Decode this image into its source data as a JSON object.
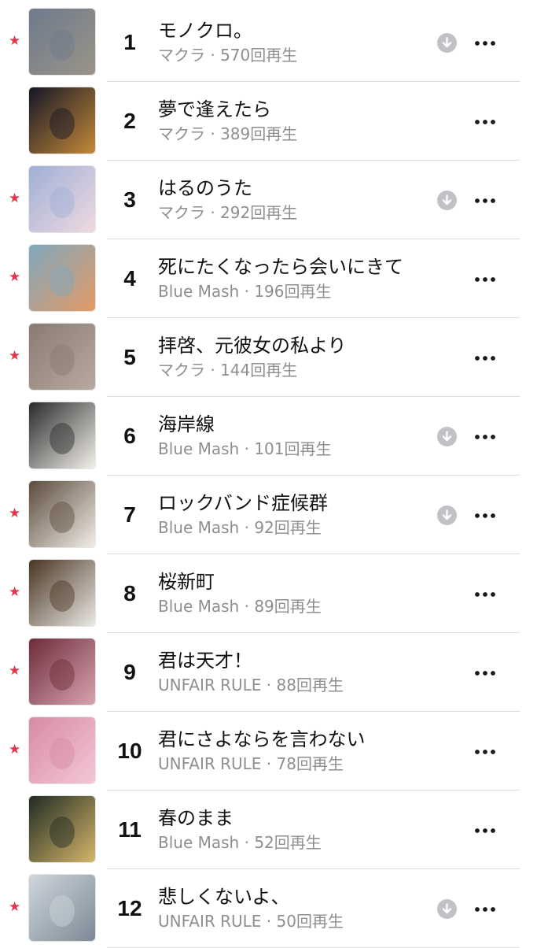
{
  "tracks": [
    {
      "rank": "1",
      "title": "モノクロ。",
      "artist": "マクラ",
      "plays": "570",
      "plays_suffix": "回再生",
      "starred": true,
      "downloaded": true,
      "art_icon": "album-art-city-silhouette",
      "art_colors": [
        "#6e7a8c",
        "#9a9488"
      ]
    },
    {
      "rank": "2",
      "title": "夢で逢えたら",
      "artist": "マクラ",
      "plays": "389",
      "plays_suffix": "回再生",
      "starred": false,
      "downloaded": false,
      "art_icon": "album-art-person-dark-room",
      "art_colors": [
        "#141526",
        "#c58b3a"
      ]
    },
    {
      "rank": "3",
      "title": "はるのうた",
      "artist": "マクラ",
      "plays": "292",
      "plays_suffix": "回再生",
      "starred": true,
      "downloaded": true,
      "art_icon": "album-art-cherry-blossoms",
      "art_colors": [
        "#9fb0d6",
        "#f0d9e0"
      ]
    },
    {
      "rank": "4",
      "title": "死にたくなったら会いにきて",
      "artist": "Blue Mash",
      "plays": "196",
      "plays_suffix": "回再生",
      "starred": true,
      "downloaded": false,
      "art_icon": "album-art-portrait-blue",
      "art_colors": [
        "#7fa8be",
        "#e39a66"
      ]
    },
    {
      "rank": "5",
      "title": "拝啓、元彼女の私より",
      "artist": "マクラ",
      "plays": "144",
      "plays_suffix": "回再生",
      "starred": true,
      "downloaded": false,
      "art_icon": "album-art-paper-note",
      "art_colors": [
        "#8a7b72",
        "#b8aaa0"
      ]
    },
    {
      "rank": "6",
      "title": "海岸線",
      "artist": "Blue Mash",
      "plays": "101",
      "plays_suffix": "回再生",
      "starred": false,
      "downloaded": true,
      "art_icon": "album-art-person-night-street",
      "art_colors": [
        "#2a2a2a",
        "#f4f1ec"
      ]
    },
    {
      "rank": "7",
      "title": "ロックバンド症候群",
      "artist": "Blue Mash",
      "plays": "92",
      "plays_suffix": "回再生",
      "starred": true,
      "downloaded": true,
      "art_icon": "album-art-room-collage",
      "art_colors": [
        "#5b4b3c",
        "#f2eee8"
      ]
    },
    {
      "rank": "8",
      "title": "桜新町",
      "artist": "Blue Mash",
      "plays": "89",
      "plays_suffix": "回再生",
      "starred": true,
      "downloaded": false,
      "art_icon": "album-art-person-warm-light",
      "art_colors": [
        "#4a3524",
        "#ebe9e4"
      ]
    },
    {
      "rank": "9",
      "title": "君は天才！",
      "artist": "UNFAIR RULE",
      "plays": "88",
      "plays_suffix": "回再生",
      "starred": true,
      "downloaded": false,
      "art_icon": "album-art-blurred-face",
      "art_colors": [
        "#6b2c3a",
        "#d9a3b0"
      ]
    },
    {
      "rank": "10",
      "title": "君にさよならを言わない",
      "artist": "UNFAIR RULE",
      "plays": "78",
      "plays_suffix": "回再生",
      "starred": true,
      "downloaded": false,
      "art_icon": "album-art-child-pink",
      "art_colors": [
        "#d88aa6",
        "#f3c7d6"
      ]
    },
    {
      "rank": "11",
      "title": "春のまま",
      "artist": "Blue Mash",
      "plays": "52",
      "plays_suffix": "回再生",
      "starred": false,
      "downloaded": false,
      "art_icon": "album-art-alley-night",
      "art_colors": [
        "#1f2b24",
        "#d6b66a"
      ]
    },
    {
      "rank": "12",
      "title": "悲しくないよ、",
      "artist": "UNFAIR RULE",
      "plays": "50",
      "plays_suffix": "回再生",
      "starred": true,
      "downloaded": true,
      "art_icon": "album-art-bridge-river",
      "art_colors": [
        "#cfd6dc",
        "#7d8a96"
      ]
    }
  ],
  "colors": {
    "star": "#e8334a",
    "secondary_text": "#8e8e93",
    "download_badge": "#c2c2c6",
    "divider": "#dcdcdc"
  },
  "icons": {
    "star": "star-icon",
    "download": "downloaded-icon",
    "more": "more-icon"
  }
}
